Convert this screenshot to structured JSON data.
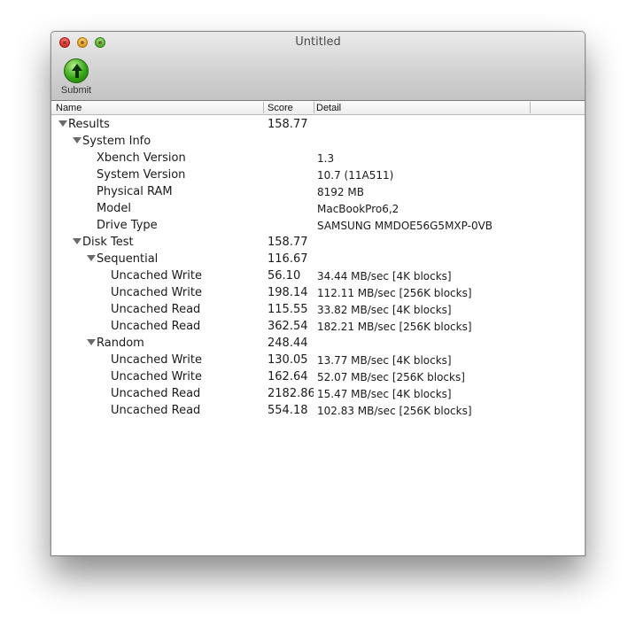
{
  "window": {
    "title": "Untitled"
  },
  "toolbar": {
    "submit_label": "Submit"
  },
  "table": {
    "columns": [
      "Name",
      "Score",
      "Detail"
    ],
    "rows": [
      {
        "name": "Results",
        "score": "158.77",
        "detail": "",
        "expanded": true
      },
      {
        "name": "System Info",
        "score": "",
        "detail": "",
        "expanded": true
      },
      {
        "name": "Xbench Version",
        "score": "",
        "detail": "1.3"
      },
      {
        "name": "System Version",
        "score": "",
        "detail": "10.7 (11A511)"
      },
      {
        "name": "Physical RAM",
        "score": "",
        "detail": "8192 MB"
      },
      {
        "name": "Model",
        "score": "",
        "detail": "MacBookPro6,2"
      },
      {
        "name": "Drive Type",
        "score": "",
        "detail": "SAMSUNG MMDOE56G5MXP-0VB"
      },
      {
        "name": "Disk Test",
        "score": "158.77",
        "detail": "",
        "expanded": true
      },
      {
        "name": "Sequential",
        "score": "116.67",
        "detail": "",
        "expanded": true
      },
      {
        "name": "Uncached Write",
        "score": "56.10",
        "detail": "34.44 MB/sec [4K blocks]"
      },
      {
        "name": "Uncached Write",
        "score": "198.14",
        "detail": "112.11 MB/sec [256K blocks]"
      },
      {
        "name": "Uncached Read",
        "score": "115.55",
        "detail": "33.82 MB/sec [4K blocks]"
      },
      {
        "name": "Uncached Read",
        "score": "362.54",
        "detail": "182.21 MB/sec [256K blocks]"
      },
      {
        "name": "Random",
        "score": "248.44",
        "detail": "",
        "expanded": true
      },
      {
        "name": "Uncached Write",
        "score": "130.05",
        "detail": "13.77 MB/sec [4K blocks]"
      },
      {
        "name": "Uncached Write",
        "score": "162.64",
        "detail": "52.07 MB/sec [256K blocks]"
      },
      {
        "name": "Uncached Read",
        "score": "2182.86",
        "detail": "15.47 MB/sec [4K blocks]"
      },
      {
        "name": "Uncached Read",
        "score": "554.18",
        "detail": "102.83 MB/sec [256K blocks]"
      }
    ]
  },
  "icons": {
    "close": "close-icon",
    "minimize": "minimize-icon",
    "maximize": "maximize-icon",
    "submit": "arrow-up-icon",
    "disclosure": "disclosure-triangle-icon"
  },
  "colors": {
    "close": "#d8352a",
    "minimize": "#e1a52a",
    "maximize": "#56b532",
    "submit": "#35a615"
  }
}
